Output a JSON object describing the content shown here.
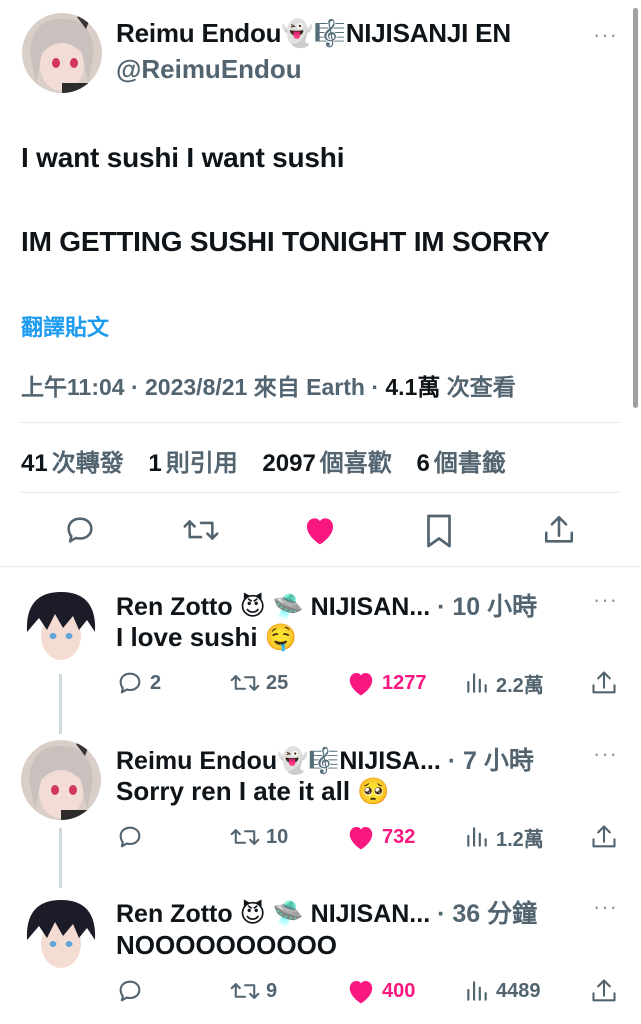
{
  "main_tweet": {
    "author_name": "Reimu Endou👻🎼NIJISANJI EN",
    "handle": "@ReimuEndou",
    "line1": "I want sushi I want sushi",
    "line2": "IM GETTING SUSHI TONIGHT IM SORRY",
    "translate_label": "翻譯貼文",
    "time": "上午11:04",
    "date": "2023/8/21",
    "source_prefix": "來自",
    "source": "Earth",
    "views_count": "4.1萬",
    "views_label": "次查看",
    "retweets_count": "41",
    "retweets_label": "次轉發",
    "quotes_count": "1",
    "quotes_label": "則引用",
    "likes_count": "2097",
    "likes_label": "個喜歡",
    "bookmarks_count": "6",
    "bookmarks_label": "個書籤"
  },
  "replies": [
    {
      "author_name": "Ren Zotto 😈 🛸 NIJISAN...",
      "time": "10 小時",
      "text": "I love sushi 🤤",
      "reply_count": "2",
      "retweet_count": "25",
      "like_count": "1277",
      "view_count": "2.2萬"
    },
    {
      "author_name": "Reimu Endou👻🎼NIJISA...",
      "time": "7 小時",
      "text": "Sorry ren I ate it all 🥺",
      "reply_count": "",
      "retweet_count": "10",
      "like_count": "732",
      "view_count": "1.2萬"
    },
    {
      "author_name": "Ren Zotto 😈 🛸 NIJISAN...",
      "time": "36 分鐘",
      "text": "NOOOOOOOOOO",
      "reply_count": "",
      "retweet_count": "9",
      "like_count": "400",
      "view_count": "4489"
    }
  ],
  "more_label": "···",
  "colors": {
    "like_active": "#f91880",
    "link": "#1d9bf0",
    "muted": "#536471"
  }
}
